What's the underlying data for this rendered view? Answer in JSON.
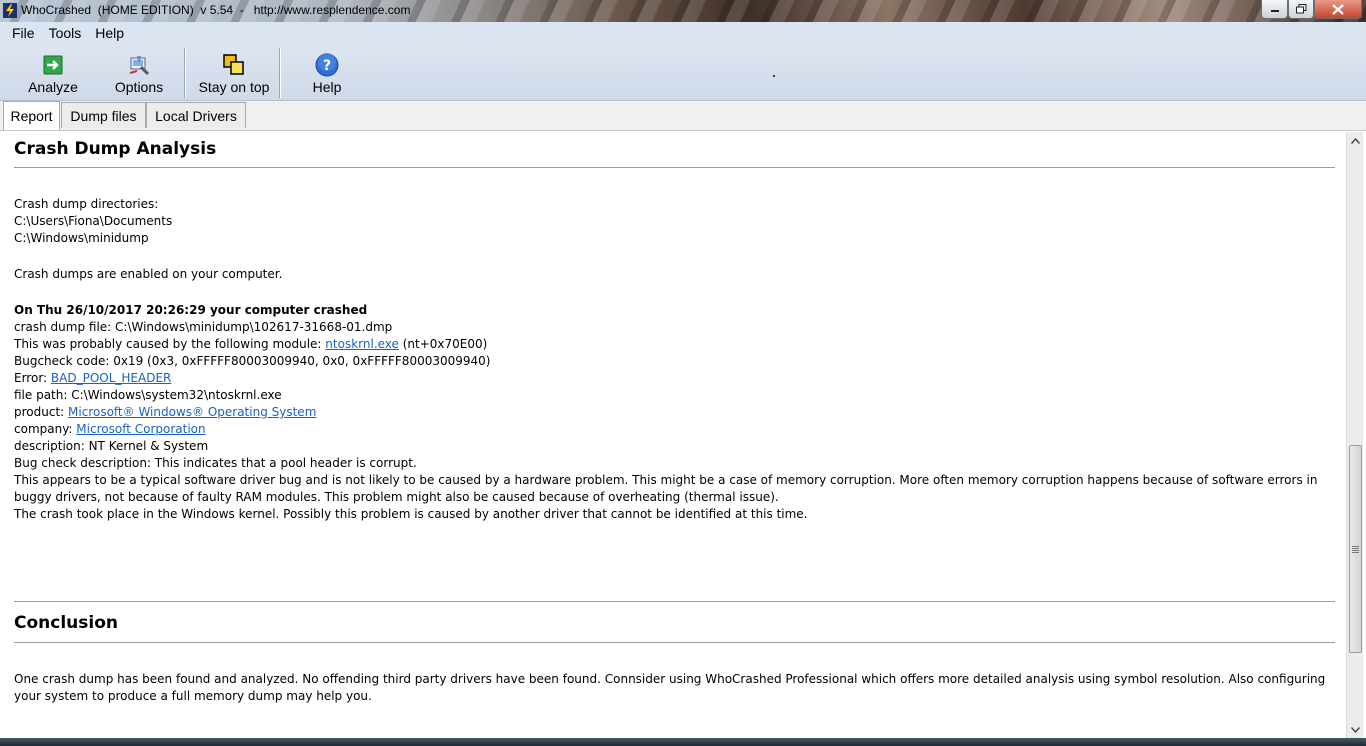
{
  "window": {
    "title": "WhoCrashed  (HOME EDITION)  v 5.54  -   http://www.resplendence.com",
    "app_icon": "lightning-icon",
    "controls": [
      "minimize-icon",
      "maximize-icon",
      "close-icon"
    ]
  },
  "menu": {
    "items": [
      {
        "label": "File"
      },
      {
        "label": "Tools"
      },
      {
        "label": "Help"
      }
    ]
  },
  "toolbar": {
    "analyze_label": "Analyze",
    "options_label": "Options",
    "stay_on_top_label": "Stay on top",
    "help_label": "Help",
    "icons": {
      "analyze": "green-arrow-icon",
      "options": "options-icon",
      "stay_on_top": "stacked-windows-icon",
      "help": "question-icon"
    }
  },
  "tabs": [
    {
      "label": "Report",
      "active": true
    },
    {
      "label": "Dump files",
      "active": false
    },
    {
      "label": "Local Drivers",
      "active": false
    }
  ],
  "report": {
    "heading": "Crash Dump Analysis",
    "dirs_label": "Crash dump directories:",
    "dir1": "C:\\Users\\Fiona\\Documents",
    "dir2": "C:\\Windows\\minidump",
    "enabled_text": "Crash dumps are enabled on your computer.",
    "crash_header": "On Thu 26/10/2017 20:26:29 your computer crashed",
    "dump_file": "crash dump file: C:\\Windows\\minidump\\102617-31668-01.dmp",
    "caused_prefix": "This was probably caused by the following module: ",
    "caused_module": "ntoskrnl.exe",
    "caused_suffix": " (nt+0x70E00)",
    "bugcheck_code": "Bugcheck code: 0x19 (0x3, 0xFFFFF80003009940, 0x0, 0xFFFFF80003009940)",
    "error_prefix": "Error: ",
    "error_link": "BAD_POOL_HEADER",
    "file_path": "file path: C:\\Windows\\system32\\ntoskrnl.exe",
    "product_prefix": "product: ",
    "product_link": "Microsoft® Windows® Operating System",
    "company_prefix": "company: ",
    "company_link": "Microsoft Corporation",
    "description": "description: NT Kernel & System",
    "bug_check_description": "Bug check description: This indicates that a pool header is corrupt.",
    "analysis": "This appears to be a typical software driver bug and is not likely to be caused by a hardware problem. This might be a case of memory corruption. More often memory corruption happens because of software errors in buggy drivers, not because of faulty RAM modules. This problem might also be caused because of overheating (thermal issue).",
    "kernel_note": "The crash took place in the Windows kernel. Possibly this problem is caused by another driver that cannot be identified at this time."
  },
  "conclusion": {
    "heading": "Conclusion",
    "text": "One crash dump has been found and analyzed. No offending third party drivers have been found. Connsider using WhoCrashed Professional which offers more detailed analysis using symbol resolution. Also configuring your system to produce a full memory dump may help you."
  },
  "colors": {
    "link": "#1a62c5",
    "toolbar_bg": "#d6dfec",
    "menubar_bg": "#dbe4f1"
  }
}
